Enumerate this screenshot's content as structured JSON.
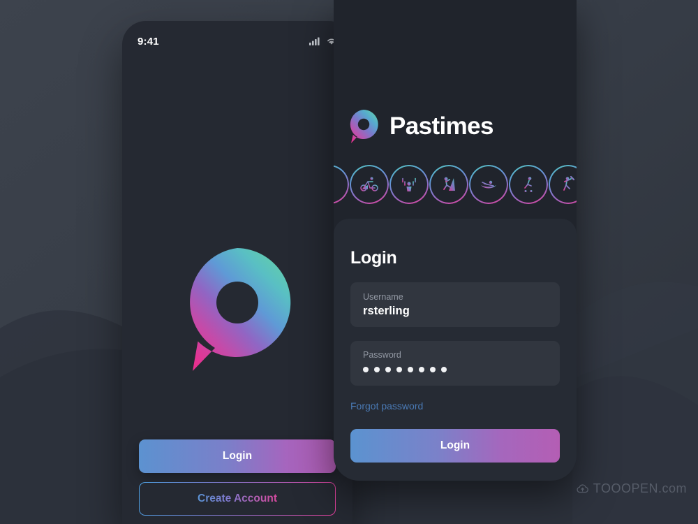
{
  "brand": {
    "name": "Pastimes",
    "logo_icon": "pastimes-pin-logo"
  },
  "left_phone": {
    "status_bar": {
      "time": "9:41",
      "signal_icon": "cellular-signal-icon",
      "wifi_icon": "wifi-icon"
    },
    "logo_icon": "pastimes-pin-logo-large",
    "login_button": "Login",
    "create_account_button": "Create Account"
  },
  "right_phone": {
    "sports": [
      {
        "name": "cycling",
        "icon": "cycling-icon"
      },
      {
        "name": "weightlifting",
        "icon": "weightlifting-icon"
      },
      {
        "name": "climbing",
        "icon": "climbing-icon"
      },
      {
        "name": "kayaking",
        "icon": "kayaking-icon"
      },
      {
        "name": "skateboarding",
        "icon": "skateboarding-icon"
      },
      {
        "name": "baseball",
        "icon": "baseball-icon"
      }
    ],
    "login_card": {
      "title": "Login",
      "username": {
        "label": "Username",
        "value": "rsterling",
        "placeholder": "Username"
      },
      "password": {
        "label": "Password",
        "value": "••••••••",
        "dots": 8,
        "placeholder": "Password"
      },
      "forgot_password": "Forgot password",
      "submit_button": "Login"
    }
  },
  "watermark": {
    "text": "TOOOPEN.com",
    "icon": "cloud-icon"
  },
  "colors": {
    "background": "#343a44",
    "phone_left_bg": "#252932",
    "phone_right_bg": "#20242c",
    "card_bg": "#262b34",
    "field_bg": "#31363f",
    "gradient_start": "#5b93d0",
    "gradient_end": "#b45eb4",
    "accent_teal": "#55c9bd",
    "accent_pink": "#e0409a",
    "link_blue": "#4a7ab5",
    "label_grey": "#9298a3"
  }
}
